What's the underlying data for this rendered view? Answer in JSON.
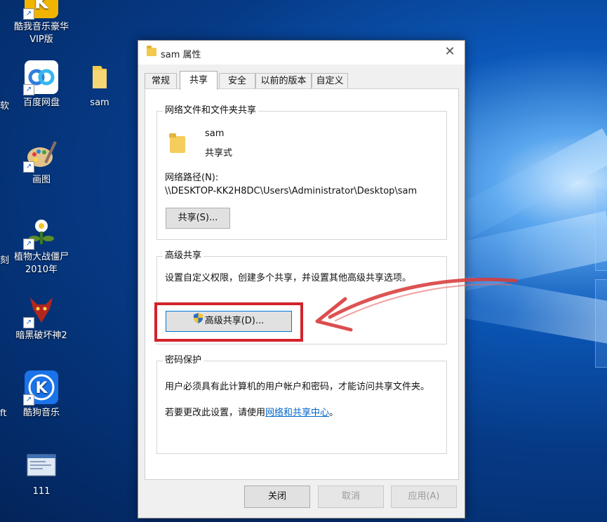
{
  "desktop": {
    "icons": [
      {
        "label": "酷我音乐豪华VIP版",
        "icon": "kuwo-music-icon",
        "color": "#f3b400"
      },
      {
        "label": "百度网盘",
        "icon": "baidu-netdisk-icon",
        "color": "#ffffff"
      },
      {
        "label": "sam",
        "icon": "folder-icon",
        "color": "#f2c94c"
      },
      {
        "label": "画图",
        "icon": "paint-palette-icon",
        "color": "#d8b36a"
      },
      {
        "label": "植物大战僵尸2010年",
        "icon": "plants-vs-zombies-icon",
        "color": "#5a8d2a"
      },
      {
        "label": "暗黑破坏神2",
        "icon": "diablo2-icon",
        "color": "#b3261e"
      },
      {
        "label": "酷狗音乐",
        "icon": "kugou-music-icon",
        "color": "#1a73e8"
      },
      {
        "label": "111",
        "icon": "document-thumbnail-icon",
        "color": "#dfe9f5"
      }
    ],
    "edge_labels": [
      "软",
      "刻",
      "ft"
    ]
  },
  "dialog": {
    "title": "sam 属性",
    "close_glyph": "✕",
    "tabs": [
      "常规",
      "共享",
      "安全",
      "以前的版本",
      "自定义"
    ],
    "active_tab": "共享",
    "network_group": {
      "title": "网络文件和文件夹共享",
      "item_name": "sam",
      "item_status": "共享式",
      "path_label": "网络路径(N):",
      "path_value": "\\\\DESKTOP-KK2H8DC\\Users\\Administrator\\Desktop\\sam",
      "share_button": "共享(S)..."
    },
    "advanced_group": {
      "title": "高级共享",
      "description": "设置自定义权限，创建多个共享，并设置其他高级共享选项。",
      "button": "高级共享(D)...",
      "shield_icon": "uac-shield-icon"
    },
    "password_group": {
      "title": "密码保护",
      "line1": "用户必须具有此计算机的用户帐户和密码，才能访问共享文件夹。",
      "line2_prefix": "若要更改此设置，请使用",
      "line2_link": "网络和共享中心",
      "line2_suffix": "。"
    },
    "footer": {
      "close": "关闭",
      "cancel": "取消",
      "apply": "应用(A)"
    }
  },
  "annotation": {
    "highlight_color": "#d3232b",
    "arrow_color": "#d83b3b"
  }
}
